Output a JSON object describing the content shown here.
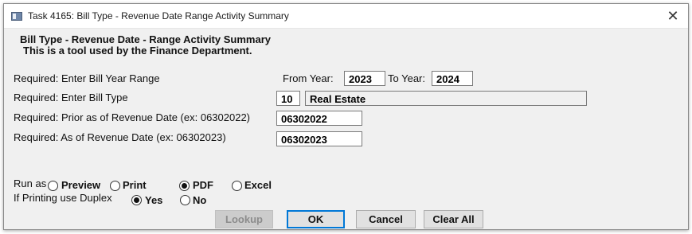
{
  "window": {
    "title": "Task 4165: Bill Type - Revenue Date Range Activity Summary",
    "close_glyph": "✕"
  },
  "header": {
    "title": "Bill Type - Revenue Date - Range Activity Summary",
    "subtitle": "This is a tool used by the Finance Department."
  },
  "form": {
    "year_range_label": "Required: Enter Bill Year Range",
    "from_year_label": "From Year:",
    "from_year_value": "2023",
    "to_year_label": "To Year:",
    "to_year_value": "2024",
    "bill_type_label": "Required: Enter Bill Type",
    "bill_type_code": "10",
    "bill_type_name": "Real Estate",
    "prior_date_label": "Required: Prior as of Revenue Date (ex: 06302022)",
    "prior_date_value": "06302022",
    "as_of_date_label": "Required: As of Revenue Date (ex: 06302023)",
    "as_of_date_value": "06302023"
  },
  "run_as": {
    "label": "Run as",
    "options": [
      "Preview",
      "Print",
      "PDF",
      "Excel"
    ],
    "selected": "PDF"
  },
  "duplex": {
    "label": "If Printing use Duplex",
    "options": [
      "Yes",
      "No"
    ],
    "selected": "Yes"
  },
  "buttons": {
    "lookup": "Lookup",
    "ok": "OK",
    "cancel": "Cancel",
    "clear_all": "Clear All"
  }
}
